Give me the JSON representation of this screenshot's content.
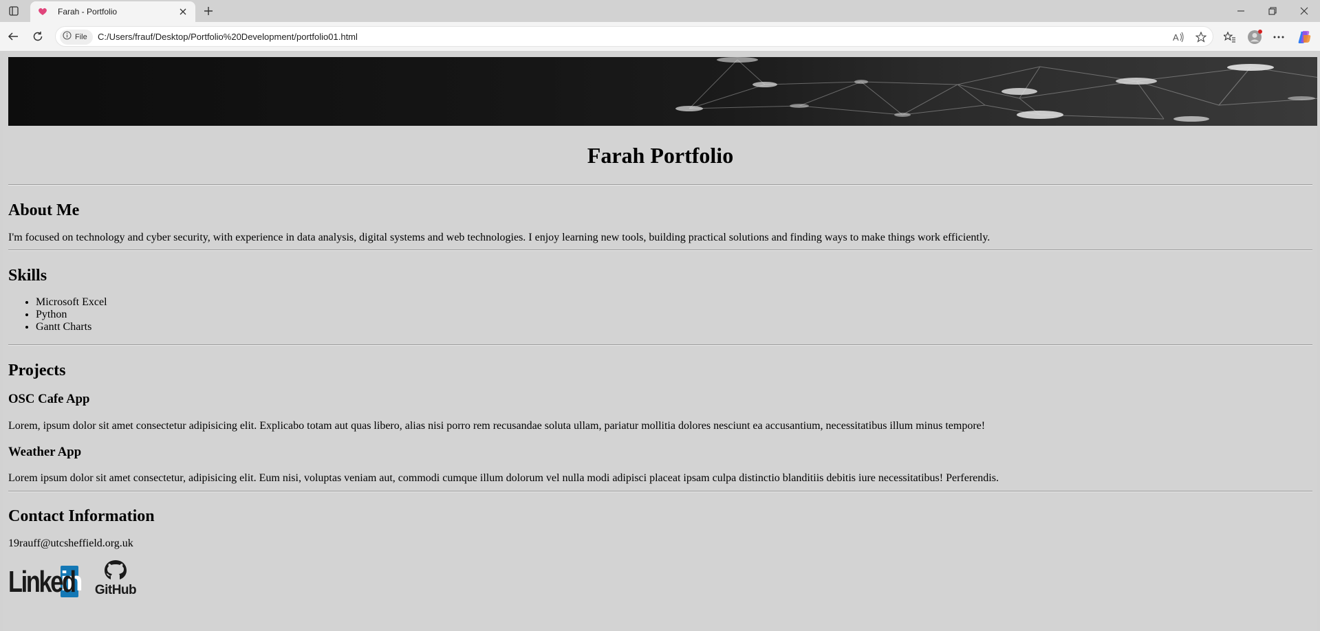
{
  "browser": {
    "tab_title": "Farah - Portfolio",
    "site_chip_label": "File",
    "url": "C:/Users/frauf/Desktop/Portfolio%20Development/portfolio01.html"
  },
  "page": {
    "title": "Farah Portfolio",
    "about": {
      "heading": "About Me",
      "text": "I'm focused on technology and cyber security, with experience in data analysis, digital systems and web technologies. I enjoy learning new tools, building practical solutions and finding ways to make things work efficiently."
    },
    "skills": {
      "heading": "Skills",
      "items": [
        "Microsoft Excel",
        "Python",
        "Gantt Charts"
      ]
    },
    "projects": {
      "heading": "Projects",
      "items": [
        {
          "title": "OSC Cafe App",
          "text": "Lorem, ipsum dolor sit amet consectetur adipisicing elit. Explicabo totam aut quas libero, alias nisi porro rem recusandae soluta ullam, pariatur mollitia dolores nesciunt ea accusantium, necessitatibus illum minus tempore!"
        },
        {
          "title": "Weather App",
          "text": "Lorem ipsum dolor sit amet consectetur, adipisicing elit. Eum nisi, voluptas veniam aut, commodi cumque illum dolorum vel nulla modi adipisci placeat ipsam culpa distinctio blanditiis debitis iure necessitatibus! Perferendis."
        }
      ]
    },
    "contact": {
      "heading": "Contact Information",
      "email": "19rauff@utcsheffield.org.uk",
      "linkedin_logo_text": "Linked",
      "linkedin_logo_box": "in",
      "github_logo_text": "GitHub"
    }
  },
  "colors": {
    "page_background": "#d3d3d3",
    "linkedin_blue": "#1478b5",
    "chrome_background": "#f4f4f4"
  }
}
